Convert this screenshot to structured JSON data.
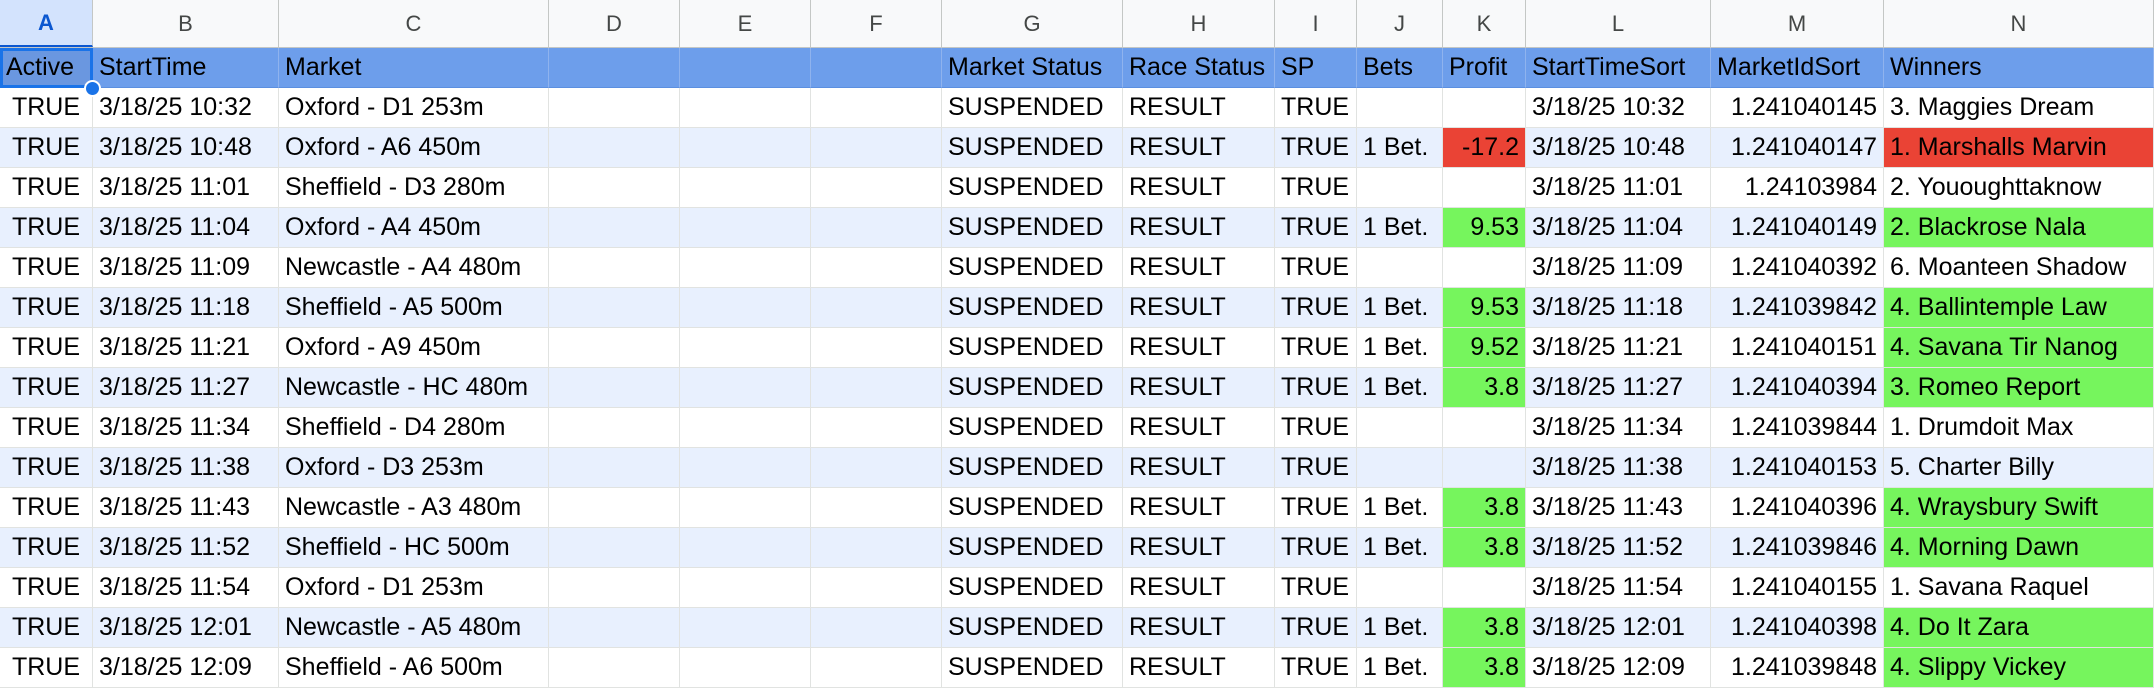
{
  "columns": [
    "A",
    "B",
    "C",
    "D",
    "E",
    "F",
    "G",
    "H",
    "I",
    "J",
    "K",
    "L",
    "M",
    "N"
  ],
  "selected_column": "A",
  "colors": {
    "header_bg": "#6d9eeb",
    "alt_row": "#e8f0fe",
    "profit_positive": "#76f55d",
    "profit_negative": "#ea4335"
  },
  "headers": [
    "Active",
    "StartTime",
    "Market",
    "",
    "",
    "",
    "Market Status",
    "Race Status",
    "SP",
    "Bets",
    "Profit",
    "StartTimeSort",
    "MarketIdSort",
    "Winners"
  ],
  "rows": [
    {
      "active": "TRUE",
      "start": "3/18/25 10:32",
      "market": "Oxford - D1 253m",
      "mstatus": "SUSPENDED",
      "rstatus": "RESULT",
      "sp": "TRUE",
      "bets": "",
      "profit": "",
      "profit_state": "",
      "sort": "3/18/25 10:32",
      "mid": "1.241040145",
      "winner": "3. Maggies Dream"
    },
    {
      "active": "TRUE",
      "start": "3/18/25 10:48",
      "market": "Oxford - A6 450m",
      "mstatus": "SUSPENDED",
      "rstatus": "RESULT",
      "sp": "TRUE",
      "bets": "1 Bet.",
      "profit": "-17.2",
      "profit_state": "neg",
      "sort": "3/18/25 10:48",
      "mid": "1.241040147",
      "winner": "1. Marshalls Marvin"
    },
    {
      "active": "TRUE",
      "start": "3/18/25 11:01",
      "market": "Sheffield - D3 280m",
      "mstatus": "SUSPENDED",
      "rstatus": "RESULT",
      "sp": "TRUE",
      "bets": "",
      "profit": "",
      "profit_state": "",
      "sort": "3/18/25 11:01",
      "mid": "1.24103984",
      "winner": "2. Yououghttaknow"
    },
    {
      "active": "TRUE",
      "start": "3/18/25 11:04",
      "market": "Oxford - A4 450m",
      "mstatus": "SUSPENDED",
      "rstatus": "RESULT",
      "sp": "TRUE",
      "bets": "1 Bet.",
      "profit": "9.53",
      "profit_state": "pos",
      "sort": "3/18/25 11:04",
      "mid": "1.241040149",
      "winner": "2. Blackrose Nala"
    },
    {
      "active": "TRUE",
      "start": "3/18/25 11:09",
      "market": "Newcastle - A4 480m",
      "mstatus": "SUSPENDED",
      "rstatus": "RESULT",
      "sp": "TRUE",
      "bets": "",
      "profit": "",
      "profit_state": "",
      "sort": "3/18/25 11:09",
      "mid": "1.241040392",
      "winner": "6. Moanteen Shadow"
    },
    {
      "active": "TRUE",
      "start": "3/18/25 11:18",
      "market": "Sheffield - A5 500m",
      "mstatus": "SUSPENDED",
      "rstatus": "RESULT",
      "sp": "TRUE",
      "bets": "1 Bet.",
      "profit": "9.53",
      "profit_state": "pos",
      "sort": "3/18/25 11:18",
      "mid": "1.241039842",
      "winner": "4. Ballintemple Law"
    },
    {
      "active": "TRUE",
      "start": "3/18/25 11:21",
      "market": "Oxford - A9 450m",
      "mstatus": "SUSPENDED",
      "rstatus": "RESULT",
      "sp": "TRUE",
      "bets": "1 Bet.",
      "profit": "9.52",
      "profit_state": "pos",
      "sort": "3/18/25 11:21",
      "mid": "1.241040151",
      "winner": "4. Savana Tir Nanog"
    },
    {
      "active": "TRUE",
      "start": "3/18/25 11:27",
      "market": "Newcastle - HC 480m",
      "mstatus": "SUSPENDED",
      "rstatus": "RESULT",
      "sp": "TRUE",
      "bets": "1 Bet.",
      "profit": "3.8",
      "profit_state": "pos",
      "sort": "3/18/25 11:27",
      "mid": "1.241040394",
      "winner": "3. Romeo Report"
    },
    {
      "active": "TRUE",
      "start": "3/18/25 11:34",
      "market": "Sheffield - D4 280m",
      "mstatus": "SUSPENDED",
      "rstatus": "RESULT",
      "sp": "TRUE",
      "bets": "",
      "profit": "",
      "profit_state": "",
      "sort": "3/18/25 11:34",
      "mid": "1.241039844",
      "winner": "1. Drumdoit Max"
    },
    {
      "active": "TRUE",
      "start": "3/18/25 11:38",
      "market": "Oxford - D3 253m",
      "mstatus": "SUSPENDED",
      "rstatus": "RESULT",
      "sp": "TRUE",
      "bets": "",
      "profit": "",
      "profit_state": "",
      "sort": "3/18/25 11:38",
      "mid": "1.241040153",
      "winner": "5. Charter Billy"
    },
    {
      "active": "TRUE",
      "start": "3/18/25 11:43",
      "market": "Newcastle - A3 480m",
      "mstatus": "SUSPENDED",
      "rstatus": "RESULT",
      "sp": "TRUE",
      "bets": "1 Bet.",
      "profit": "3.8",
      "profit_state": "pos",
      "sort": "3/18/25 11:43",
      "mid": "1.241040396",
      "winner": "4. Wraysbury Swift"
    },
    {
      "active": "TRUE",
      "start": "3/18/25 11:52",
      "market": "Sheffield - HC 500m",
      "mstatus": "SUSPENDED",
      "rstatus": "RESULT",
      "sp": "TRUE",
      "bets": "1 Bet.",
      "profit": "3.8",
      "profit_state": "pos",
      "sort": "3/18/25 11:52",
      "mid": "1.241039846",
      "winner": "4. Morning Dawn"
    },
    {
      "active": "TRUE",
      "start": "3/18/25 11:54",
      "market": "Oxford - D1 253m",
      "mstatus": "SUSPENDED",
      "rstatus": "RESULT",
      "sp": "TRUE",
      "bets": "",
      "profit": "",
      "profit_state": "",
      "sort": "3/18/25 11:54",
      "mid": "1.241040155",
      "winner": "1. Savana Raquel"
    },
    {
      "active": "TRUE",
      "start": "3/18/25 12:01",
      "market": "Newcastle - A5 480m",
      "mstatus": "SUSPENDED",
      "rstatus": "RESULT",
      "sp": "TRUE",
      "bets": "1 Bet.",
      "profit": "3.8",
      "profit_state": "pos",
      "sort": "3/18/25 12:01",
      "mid": "1.241040398",
      "winner": "4. Do It Zara"
    },
    {
      "active": "TRUE",
      "start": "3/18/25 12:09",
      "market": "Sheffield - A6 500m",
      "mstatus": "SUSPENDED",
      "rstatus": "RESULT",
      "sp": "TRUE",
      "bets": "1 Bet.",
      "profit": "3.8",
      "profit_state": "pos",
      "sort": "3/18/25 12:09",
      "mid": "1.241039848",
      "winner": "4. Slippy Vickey"
    }
  ]
}
